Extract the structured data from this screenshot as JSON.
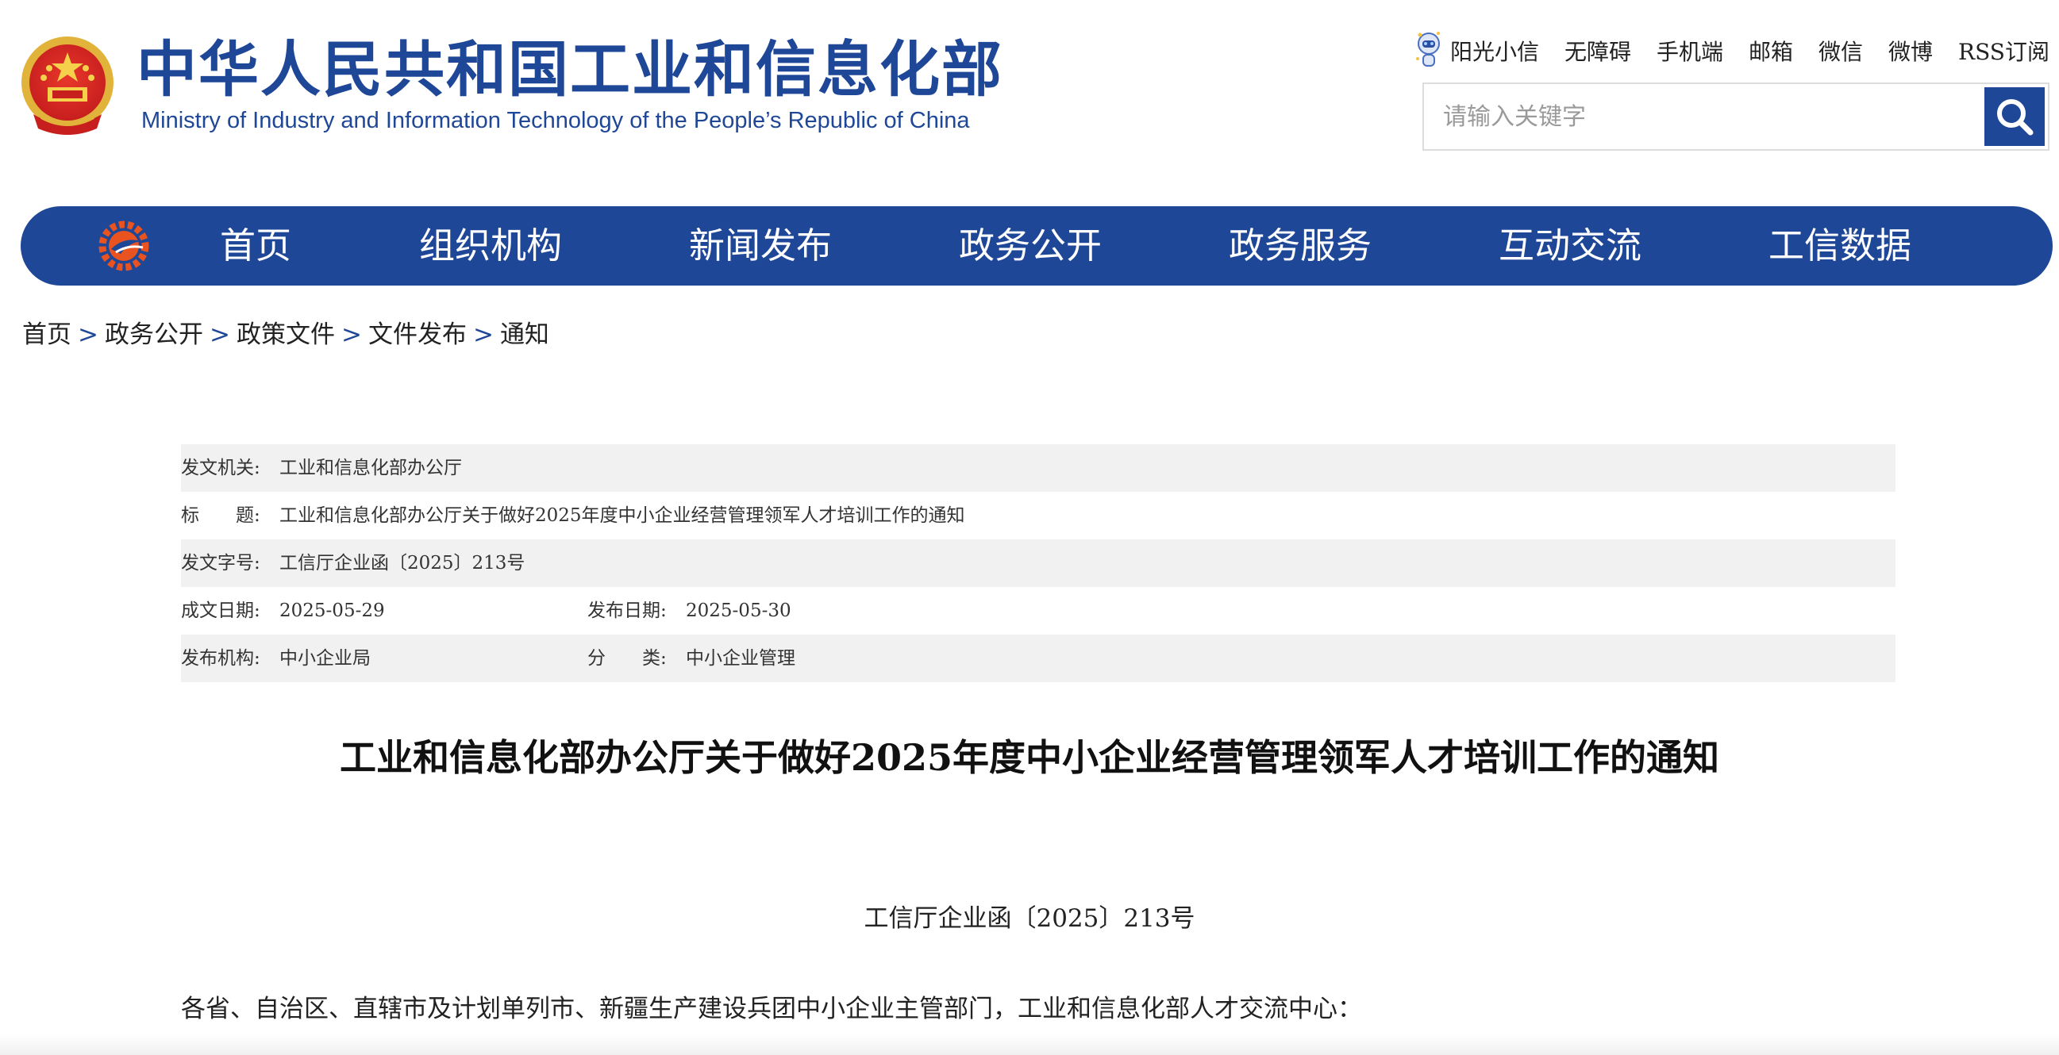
{
  "header": {
    "title_cn": "中华人民共和国工业和信息化部",
    "title_en": "Ministry of Industry and Information Technology of the People’s Republic of China",
    "emblem_icon": "national-emblem-icon",
    "top_links": [
      "阳光小信",
      "无障碍",
      "手机端",
      "邮箱",
      "微信",
      "微博",
      "RSS订阅"
    ],
    "search": {
      "placeholder": "请输入关键字",
      "value": ""
    }
  },
  "nav": {
    "items": [
      "首页",
      "组织机构",
      "新闻发布",
      "政务公开",
      "政务服务",
      "互动交流",
      "工信数据"
    ]
  },
  "breadcrumb": {
    "items": [
      "首页",
      "政务公开",
      "政策文件",
      "文件发布",
      "通知"
    ],
    "separator": ">"
  },
  "meta": {
    "issuer_label": "发文机关:",
    "issuer": "工业和信息化部办公厅",
    "title_label": "标　　题:",
    "title": "工业和信息化部办公厅关于做好2025年度中小企业经营管理领军人才培训工作的通知",
    "doc_no_label": "发文字号:",
    "doc_no": "工信厅企业函〔2025〕213号",
    "created_label": "成文日期:",
    "created": "2025-05-29",
    "published_label": "发布日期:",
    "published": "2025-05-30",
    "agency_label": "发布机构:",
    "agency": "中小企业局",
    "category_label": "分　　类:",
    "category": "中小企业管理"
  },
  "article": {
    "title": "工业和信息化部办公厅关于做好2025年度中小企业经营管理领军人才培训工作的通知",
    "doc_number": "工信厅企业函〔2025〕213号",
    "addressee": "各省、自治区、直辖市及计划单列市、新疆生产建设兵团中小企业主管部门，工业和信息化部人才交流中心："
  },
  "colors": {
    "brand_blue": "#1f4797",
    "meta_row_grey": "#f1f1f1",
    "nav_logo_orange": "#e8531f"
  }
}
